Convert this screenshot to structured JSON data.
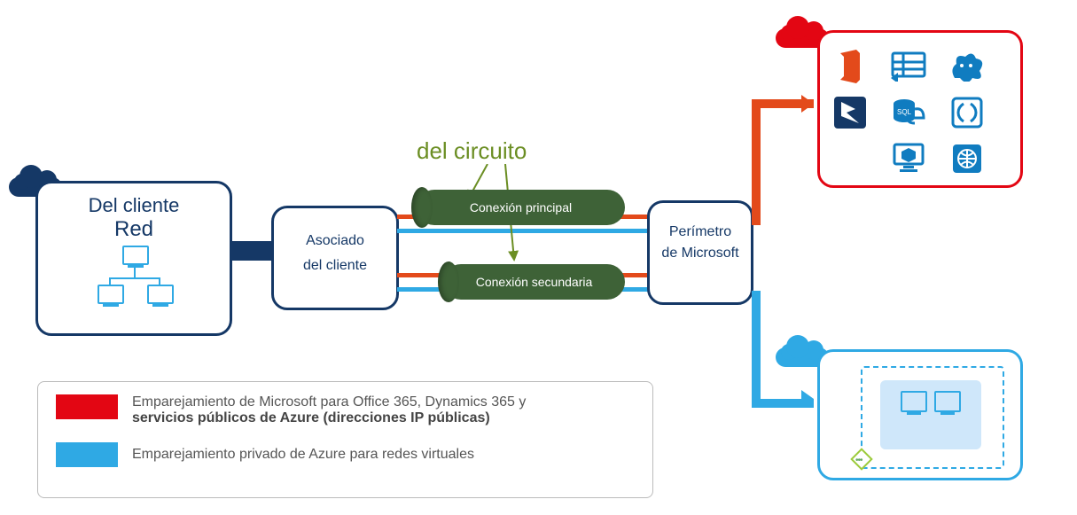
{
  "circuitLabel": "del circuito",
  "customer": {
    "title": "Del cliente",
    "subtitle": "Red"
  },
  "partner": {
    "line1": "Asociado",
    "line2": "del cliente"
  },
  "pipes": {
    "primary": "Conexión principal",
    "secondary": "Conexión secundaria"
  },
  "msEdge": {
    "line1": "Perímetro",
    "line2": "de Microsoft"
  },
  "legend": {
    "red": {
      "line1": "Emparejamiento de Microsoft para Office 365, Dynamics 365 y",
      "line2": "servicios públicos de Azure (direcciones IP públicas)"
    },
    "blue": "Emparejamiento privado de Azure para redes virtuales"
  },
  "colors": {
    "navy": "#153866",
    "red": "#E30613",
    "orange": "#E34A1B",
    "lblue": "#2FA9E4",
    "green": "#3E6237"
  },
  "msServices": [
    "office-365",
    "azure-storage",
    "hdinsight",
    "dynamics-365",
    "azure-sql",
    "azure-functions",
    "",
    "azure-vm",
    "azure-web"
  ],
  "vnet": {
    "label": "virtual-network"
  }
}
